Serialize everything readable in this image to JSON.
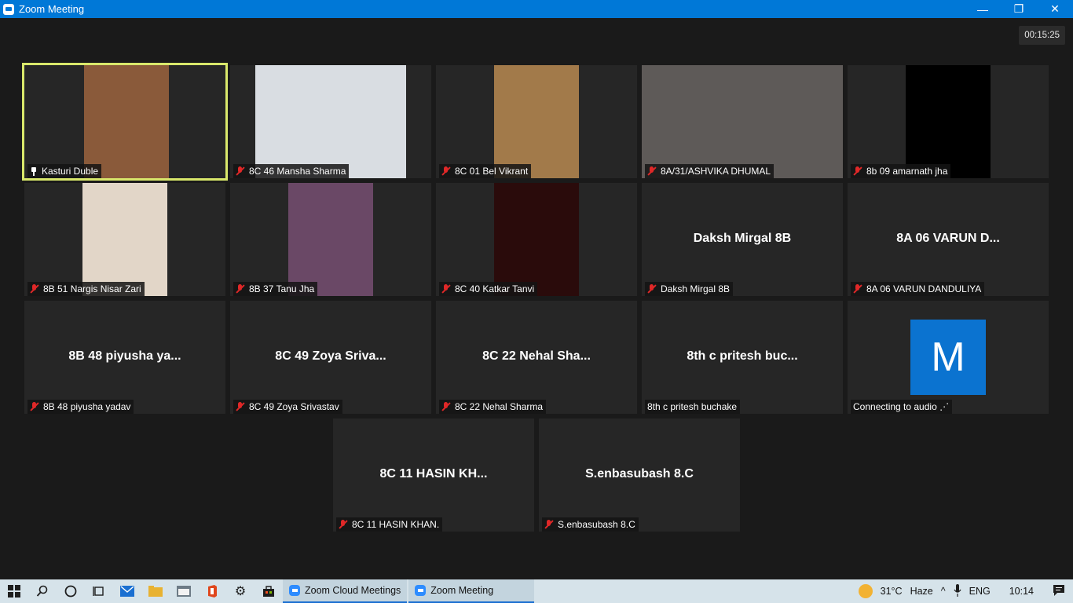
{
  "window": {
    "title": "Zoom Meeting",
    "minimize": "—",
    "maximize": "❐",
    "close": "✕"
  },
  "meeting": {
    "timer": "00:15:25"
  },
  "participants": [
    {
      "label": "Kasturi Duble",
      "icon": "pin",
      "video": true,
      "bg": "#8a5a3a",
      "vx": 76,
      "vw": 108
    },
    {
      "label": "8C 46 Mansha Sharma",
      "icon": "mute",
      "video": true,
      "bg": "#d9dde2",
      "vx": 32,
      "vw": 192
    },
    {
      "label": "8C 01 Bel Vikrant",
      "icon": "mute",
      "video": true,
      "bg": "#a27a4a",
      "vx": 74,
      "vw": 108
    },
    {
      "label": "8A/31/ASHVIKA DHUMAL",
      "icon": "mute",
      "video": true,
      "bg": "#5e5a58",
      "vx": 0,
      "vw": 256
    },
    {
      "label": "8b 09 amarnath jha",
      "icon": "mute",
      "video": true,
      "bg": "#000000",
      "vx": 74,
      "vw": 108
    },
    {
      "label": "8B 51 Nargis Nisar Zari",
      "icon": "mute",
      "video": true,
      "bg": "#e2d6c8",
      "vx": 74,
      "vw": 108
    },
    {
      "label": "8B 37 Tanu Jha",
      "icon": "mute",
      "video": true,
      "bg": "#6a4866",
      "vx": 74,
      "vw": 108
    },
    {
      "label": "8C 40 Katkar Tanvi",
      "icon": "mute",
      "video": true,
      "bg": "#2a0b0b",
      "vx": 74,
      "vw": 108
    },
    {
      "label": "Daksh Mirgal 8B",
      "icon": "mute",
      "video": false,
      "bigname": "Daksh Mirgal 8B"
    },
    {
      "label": "8A 06 VARUN DANDULIYA",
      "icon": "mute",
      "video": false,
      "bigname": "8A 06 VARUN D..."
    },
    {
      "label": "8B 48 piyusha yadav",
      "icon": "mute",
      "video": false,
      "bigname": "8B 48 piyusha ya..."
    },
    {
      "label": "8C 49 Zoya Srivastav",
      "icon": "mute",
      "video": false,
      "bigname": "8C 49 Zoya Sriva..."
    },
    {
      "label": "8C 22 Nehal Sharma",
      "icon": "mute",
      "video": false,
      "bigname": "8C 22 Nehal Sha..."
    },
    {
      "label": "8th c pritesh buchake",
      "icon": "none",
      "video": false,
      "bigname": "8th c pritesh buc..."
    },
    {
      "label": "Connecting to audio ⋰",
      "icon": "none",
      "video": false,
      "avatar": "M"
    },
    {
      "label": "8C 11 HASIN KHAN.",
      "icon": "mute",
      "video": false,
      "bigname": "8C 11 HASIN KH..."
    },
    {
      "label": "S.enbasubash 8.C",
      "icon": "mute",
      "video": false,
      "bigname": "S.enbasubash 8.C"
    }
  ],
  "taskbar": {
    "apps": [
      {
        "label": "Zoom Cloud Meetings"
      },
      {
        "label": "Zoom Meeting"
      }
    ],
    "weather": {
      "temp": "31°C",
      "condition": "Haze"
    },
    "language": "ENG",
    "time": "10:14"
  }
}
